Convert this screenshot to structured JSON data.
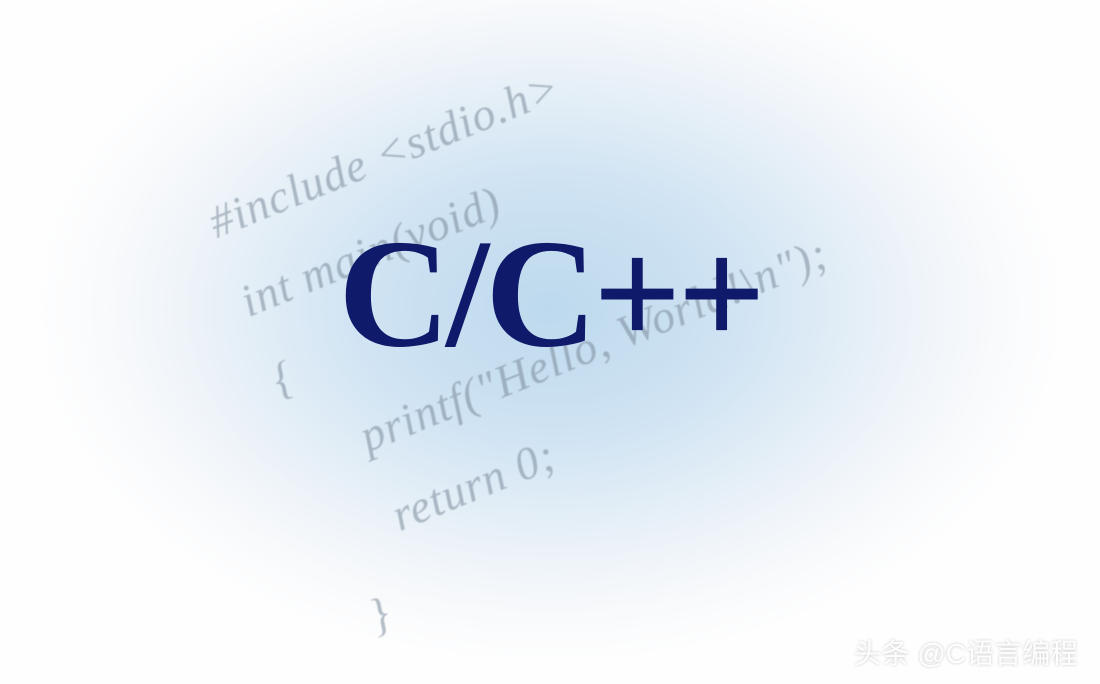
{
  "background_code": {
    "line1": "#include <stdio.h>",
    "line2": "int main(void)",
    "line3": "{",
    "line4": "printf(\"Hello, World!\\n\");",
    "line5": "return 0;",
    "line6": "}"
  },
  "title": "C/C++",
  "watermark": "头条 @C语言编程",
  "colors": {
    "title_color": "#0f1a6b",
    "code_color": "#7a8a9a",
    "bg_center": "#bdd9ed",
    "bg_outer": "#fefefe",
    "watermark_color": "#ffffff"
  }
}
